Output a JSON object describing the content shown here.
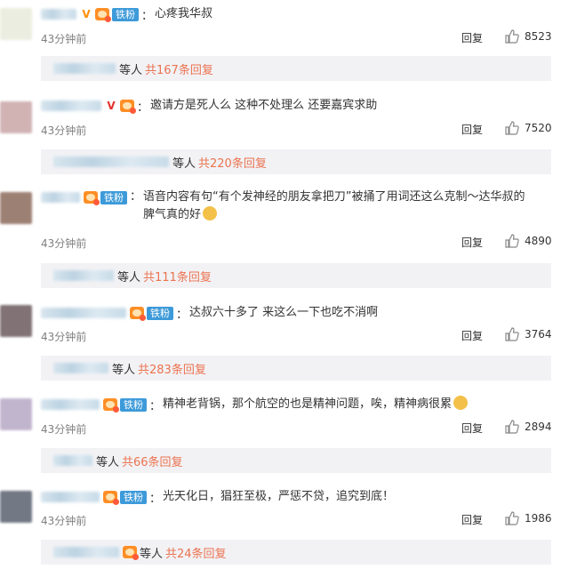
{
  "reply_label": "回复",
  "others_suffix": "等人",
  "comments": [
    {
      "text": "心疼我华叔",
      "time": "43分钟前",
      "likes": "8523",
      "sub_replies": "共167条回复",
      "avatar_color": "#e8eadb"
    },
    {
      "text": "邀请方是死人么 这种不处理么 还要嘉宾求助",
      "time": "43分钟前",
      "likes": "7520",
      "sub_replies": "共220条回复",
      "avatar_color": "#c9a6a8"
    },
    {
      "text": "语音内容有句“有个发神经的朋友拿把刀”被捅了用词还这么克制～达华叔的脾气真的好",
      "fan_tag": "铁粉",
      "time": "43分钟前",
      "likes": "4890",
      "sub_replies": "共111条回复",
      "avatar_color": "#8d6a5c"
    },
    {
      "text": "达叔六十多了 来这么一下也吃不消啊",
      "fan_tag": "铁粉",
      "time": "43分钟前",
      "likes": "3764",
      "sub_replies": "共283条回复",
      "avatar_color": "#6b5a5e"
    },
    {
      "text": "精神老背锅，那个航空的也是精神问题，唉，精神病很累",
      "fan_tag": "铁粉",
      "time": "43分钟前",
      "likes": "2894",
      "sub_replies": "共66条回复",
      "avatar_color": "#b7a9c6"
    },
    {
      "text": "光天化日，猖狂至极，严惩不贷，追究到底！",
      "fan_tag": "铁粉",
      "time": "43分钟前",
      "likes": "1986",
      "sub_replies": "共24条回复",
      "avatar_color": "#5b6170"
    }
  ]
}
